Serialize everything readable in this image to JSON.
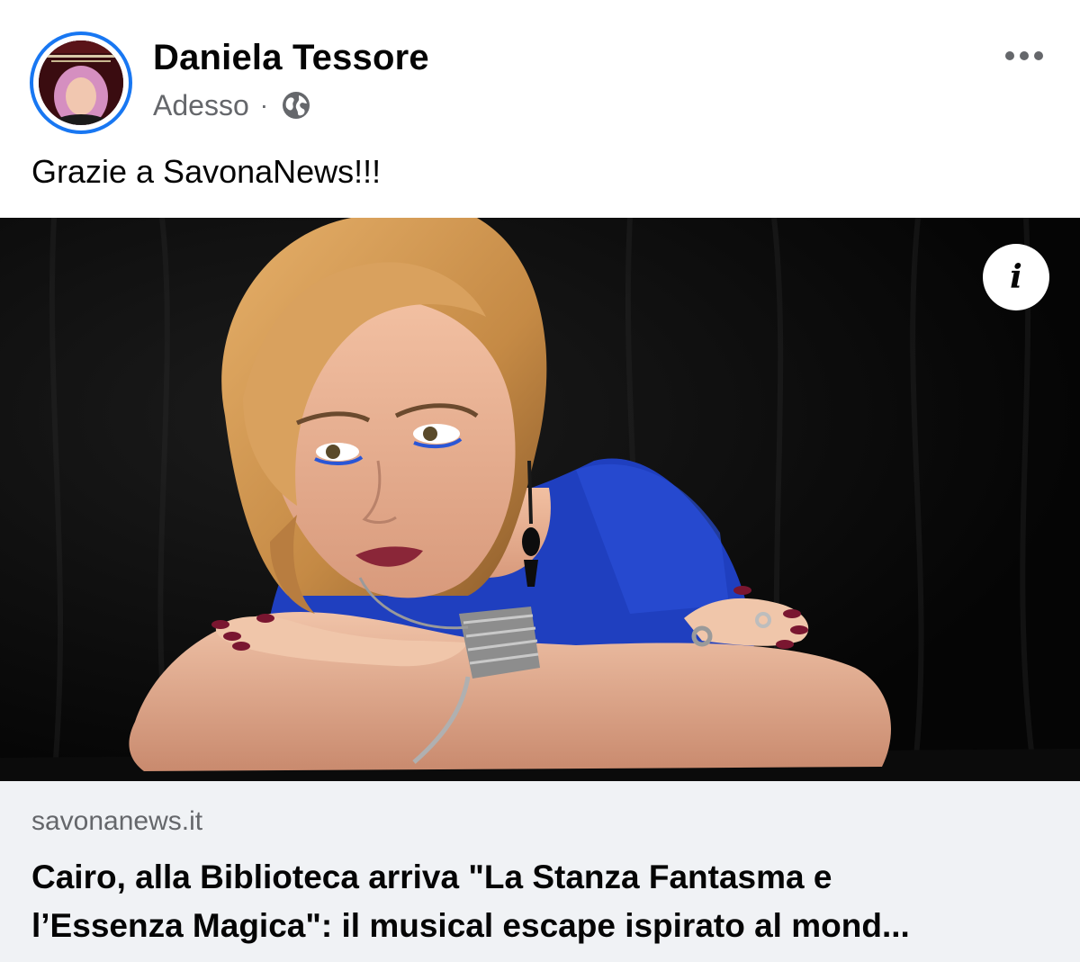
{
  "post": {
    "author": "Daniela Tessore",
    "timestamp": "Adesso",
    "separator": "·",
    "audience_icon": "globe-icon",
    "more_icon": "more-horizontal-icon",
    "text": "Grazie a SavonaNews!!!",
    "media": {
      "info_icon": "info-icon",
      "info_symbol": "i"
    },
    "link_preview": {
      "domain": "savonanews.it",
      "title_line_1": "Cairo, alla Biblioteca arriva \"La Stanza Fantasma e",
      "title_line_2": "l’Essenza Magica\": il musical escape ispirato al mond..."
    }
  },
  "colors": {
    "accent": "#1877f2",
    "secondary_text": "#65676b",
    "preview_bg": "#f0f2f5",
    "dress_blue": "#1f3fbf"
  }
}
